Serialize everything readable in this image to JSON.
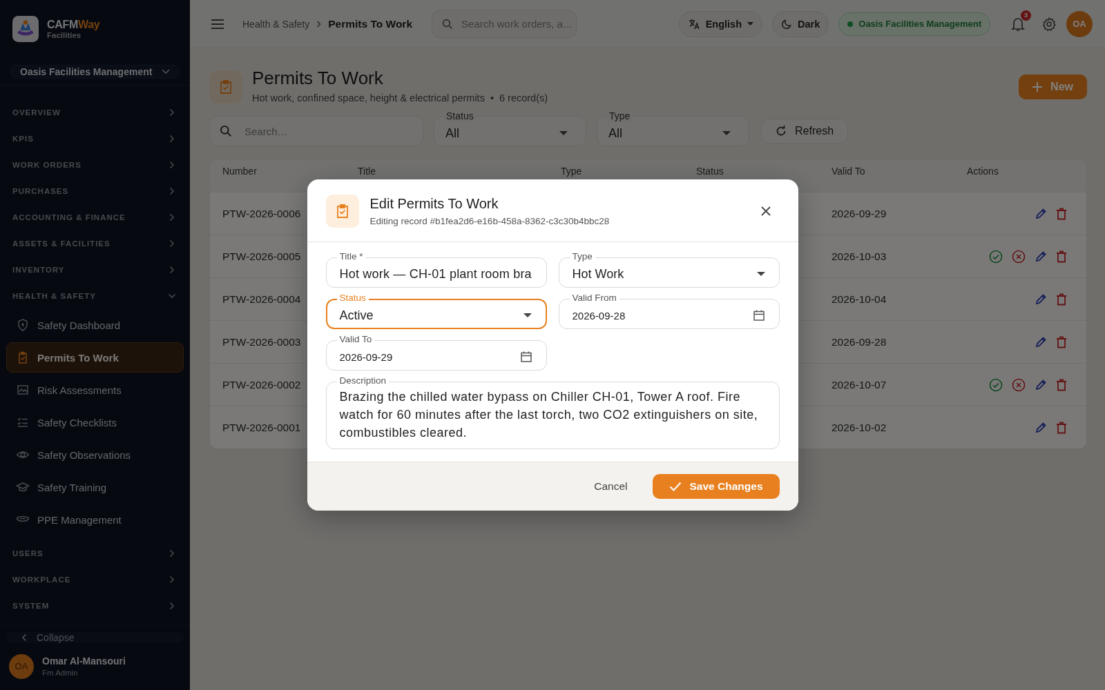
{
  "brand": {
    "name_a": "CAFM",
    "name_b": "Way",
    "subtitle": "Facilities"
  },
  "org_selector": "Oasis Facilities Management",
  "sidebar": {
    "sections": [
      {
        "label": "OVERVIEW",
        "expanded": false
      },
      {
        "label": "KPIS",
        "expanded": false
      },
      {
        "label": "WORK ORDERS",
        "expanded": false
      },
      {
        "label": "PURCHASES",
        "expanded": false
      },
      {
        "label": "ACCOUNTING & FINANCE",
        "expanded": false
      },
      {
        "label": "ASSETS & FACILITIES",
        "expanded": false
      },
      {
        "label": "INVENTORY",
        "expanded": false
      },
      {
        "label": "HEALTH & SAFETY",
        "expanded": true,
        "children": [
          {
            "label": "Safety Dashboard",
            "selected": false
          },
          {
            "label": "Permits To Work",
            "selected": true
          },
          {
            "label": "Risk Assessments",
            "selected": false
          },
          {
            "label": "Safety Checklists",
            "selected": false
          },
          {
            "label": "Safety Observations",
            "selected": false
          },
          {
            "label": "Safety Training",
            "selected": false
          },
          {
            "label": "PPE Management",
            "selected": false
          }
        ]
      },
      {
        "label": "USERS",
        "expanded": false
      },
      {
        "label": "WORKPLACE",
        "expanded": false
      },
      {
        "label": "SYSTEM",
        "expanded": false
      }
    ]
  },
  "collapse": "Collapse",
  "user": {
    "initials": "OA",
    "name": "Omar Al-Mansouri",
    "role": "Fm Admin"
  },
  "topbar": {
    "breadcrumb": [
      "Health & Safety",
      "Permits To Work"
    ],
    "search_placeholder": "Search work orders, a…",
    "language": "English",
    "theme": "Dark",
    "org_badge": "Oasis Facilities Management",
    "notifications": "3",
    "avatar": "OA"
  },
  "page": {
    "title": "Permits To Work",
    "subtitle": "Hot work, confined space, height & electrical permits",
    "separator": "•",
    "record_count": "6 record(s)",
    "new_button": "New"
  },
  "filters": {
    "search_placeholder": "Search…",
    "selects": [
      {
        "label": "Status",
        "value": "All"
      },
      {
        "label": "Type",
        "value": "All"
      }
    ],
    "refresh": "Refresh"
  },
  "table": {
    "columns": [
      "Number",
      "Title",
      "Type",
      "Status",
      "Valid To",
      "Actions"
    ],
    "rows": [
      {
        "number": "PTW-2026-0006",
        "valid_to": "2026-09-29",
        "approvable": false
      },
      {
        "number": "PTW-2026-0005",
        "valid_to": "2026-10-03",
        "approvable": true
      },
      {
        "number": "PTW-2026-0004",
        "valid_to": "2026-10-04",
        "approvable": false
      },
      {
        "number": "PTW-2026-0003",
        "valid_to": "2026-09-28",
        "approvable": false
      },
      {
        "number": "PTW-2026-0002",
        "valid_to": "2026-10-07",
        "approvable": true
      },
      {
        "number": "PTW-2026-0001",
        "valid_to": "2026-10-02",
        "approvable": false
      }
    ]
  },
  "modal": {
    "title": "Edit Permits To Work",
    "subtitle": "Editing record #b1fea2d6-e16b-458a-8362-c3c30b4bbc28",
    "fields": [
      {
        "kind": "text",
        "label": "Title *",
        "value": "Hot work — CH-01 plant room bra",
        "focused": false
      },
      {
        "kind": "select",
        "label": "Type",
        "value": "Hot Work",
        "focused": false
      },
      {
        "kind": "select",
        "label": "Status",
        "value": "Active",
        "focused": true
      },
      {
        "kind": "date",
        "label": "Valid From",
        "value": "2026-09-28",
        "focused": false
      },
      {
        "kind": "date",
        "label": "Valid To",
        "value": "2026-09-29",
        "focused": false
      },
      {
        "kind": "textarea",
        "label": "Description",
        "value": "Brazing the chilled water bypass on Chiller CH-01, Tower A roof. Fire watch for 60 minutes after the last torch, two CO2 extinguishers on site, combustibles cleared.",
        "focused": false
      }
    ],
    "cancel": "Cancel",
    "save": "Save Changes"
  }
}
